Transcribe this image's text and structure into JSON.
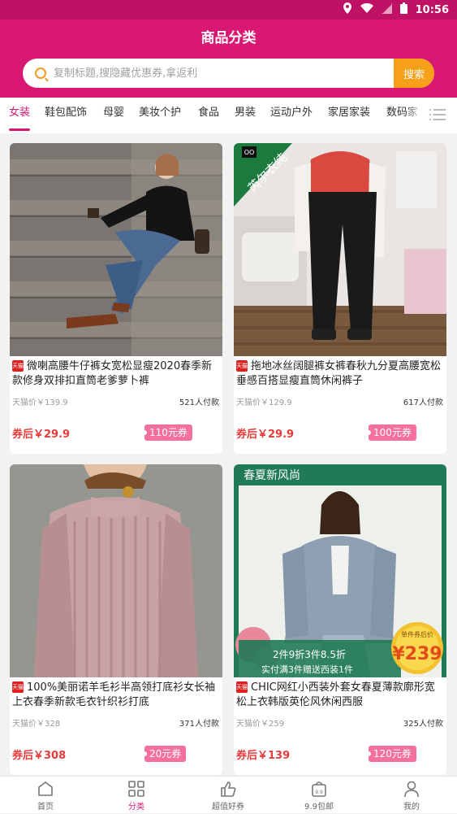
{
  "status": {
    "time": "10:56"
  },
  "header": {
    "title": "商品分类"
  },
  "search": {
    "placeholder": "复制标题,搜隐藏优惠券,拿返利",
    "button": "搜索"
  },
  "categories": [
    "女装",
    "鞋包配饰",
    "母婴",
    "美妆个护",
    "食品",
    "男装",
    "运动户外",
    "家居家装",
    "数码家"
  ],
  "products": [
    {
      "title": "微喇高腰牛仔裤女宽松显瘦2020春季新款修身双排扣直筒老爹萝卜裤",
      "original_price": "天猫价￥139.9",
      "sold": "521人付款",
      "after_coupon": "券后￥29.9",
      "coupon": "110元券",
      "badge": "天猫"
    },
    {
      "title": "拖地冰丝阔腿裤女裤春秋九分夏高腰宽松垂感百搭显瘦直筒休闲裤子",
      "original_price": "天猫价￥129.9",
      "sold": "617人付款",
      "after_coupon": "券后￥29.9",
      "coupon": "100元券",
      "badge": "天猫",
      "overlay_text": "芮尔衣纯"
    },
    {
      "title": "100%美丽诺羊毛衫半高领打底衫女长袖上衣春季新款毛衣针织衫打底",
      "original_price": "天猫价￥328",
      "sold": "371人付款",
      "after_coupon": "券后￥308",
      "coupon": "20元券",
      "badge": "天猫"
    },
    {
      "title": "CHIC网红小西装外套女春夏薄款廓形宽松上衣韩版英伦风休闲西服",
      "original_price": "天猫价￥259",
      "sold": "325人付款",
      "after_coupon": "券后￥139",
      "coupon": "120元券",
      "badge": "天猫",
      "banner_top": "春夏新风尚",
      "promo_line1": "2件9折3件8.5折",
      "promo_line2": "实付满3件赠送西装1件",
      "price_tag_label": "单件券后价",
      "price_tag_value": "¥239"
    }
  ],
  "tabbar": [
    "首页",
    "分类",
    "超值好券",
    "9.9包邮",
    "我的"
  ],
  "colors": {
    "brand": "#d81873",
    "search_button": "#f7a11a",
    "price": "#e73a3a"
  }
}
